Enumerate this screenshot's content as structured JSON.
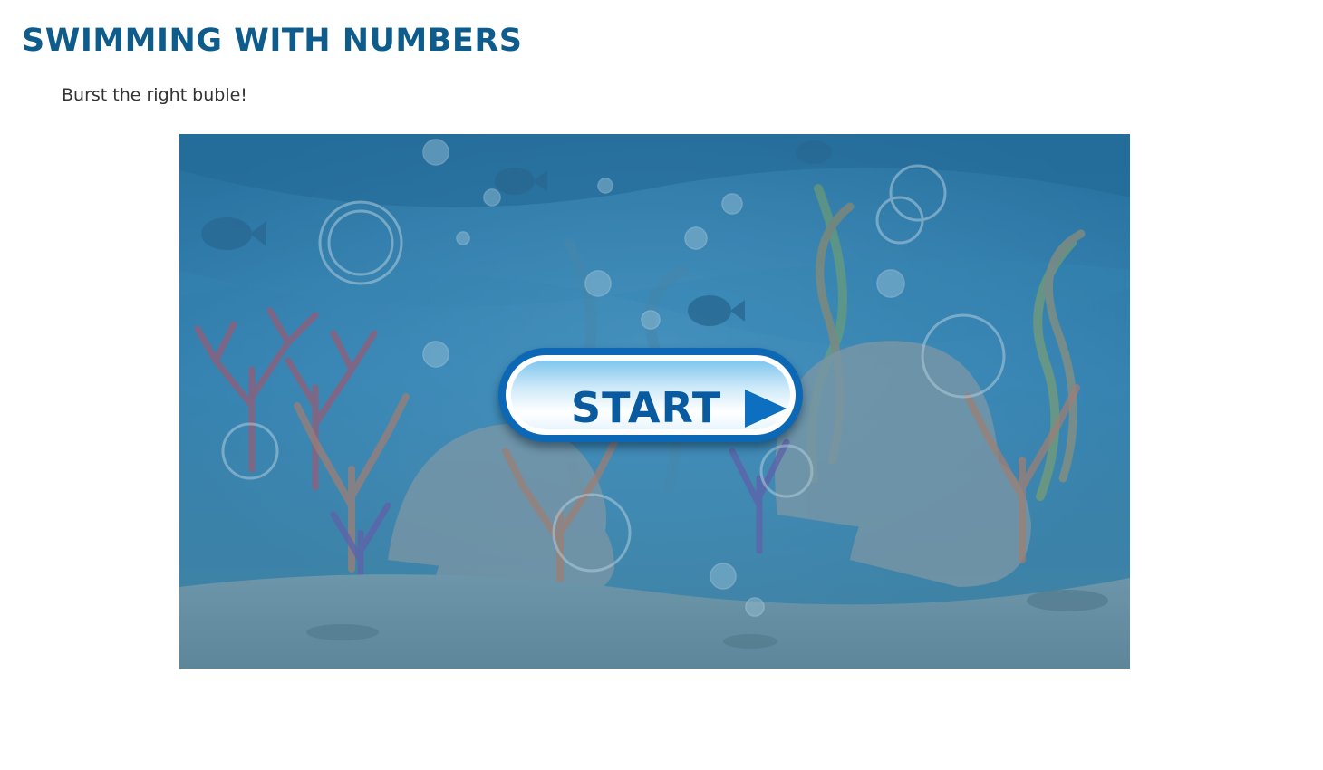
{
  "page": {
    "title": "SWIMMING WITH NUMBERS",
    "subtitle": "Burst the right buble!"
  },
  "game": {
    "start_button_label": "START",
    "play_icon": "play-triangle-icon",
    "colors": {
      "title": "#0d5c8c",
      "water": "#2f7fb0",
      "button_ring": "#0c68b4",
      "button_text": "#0a5aa0"
    }
  }
}
